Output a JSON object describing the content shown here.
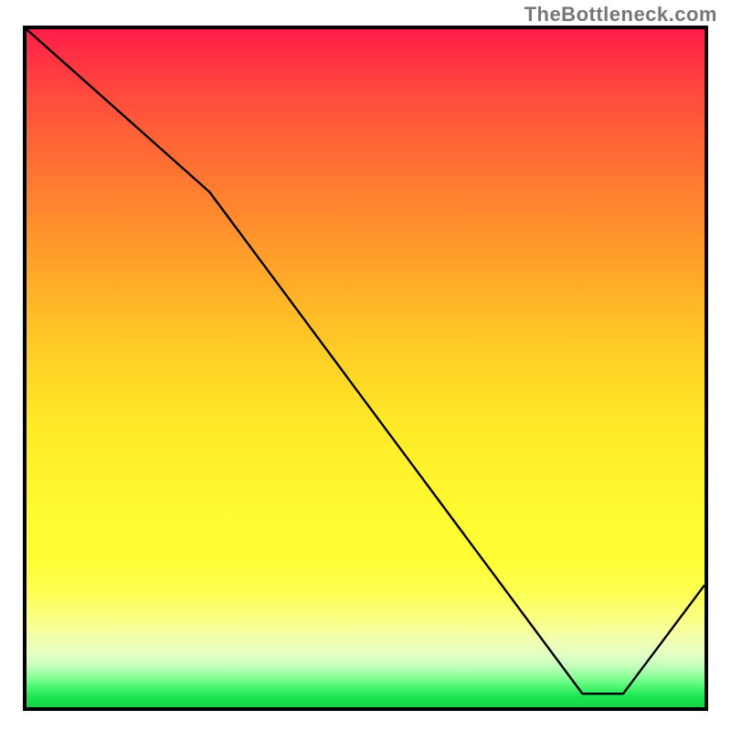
{
  "watermark": "TheBottleneck.com",
  "marker_label": "",
  "chart_data": {
    "type": "line",
    "title": "",
    "xlabel": "",
    "ylabel": "",
    "xlim": [
      0,
      100
    ],
    "ylim": [
      0,
      100
    ],
    "x": [
      0,
      27,
      82,
      88,
      100
    ],
    "values": [
      100,
      76,
      2,
      2,
      18
    ],
    "notes": "Background is a vertical heat gradient from red (top / high y) through orange and yellow to green (bottom / low y). A single black polyline descends from the top-left corner, has a slope change near x≈27, reaches a minimum plateau around x≈82–88, then rises toward the right edge. A small orange text marker sits at the trough.",
    "grid": false,
    "legend": false
  }
}
